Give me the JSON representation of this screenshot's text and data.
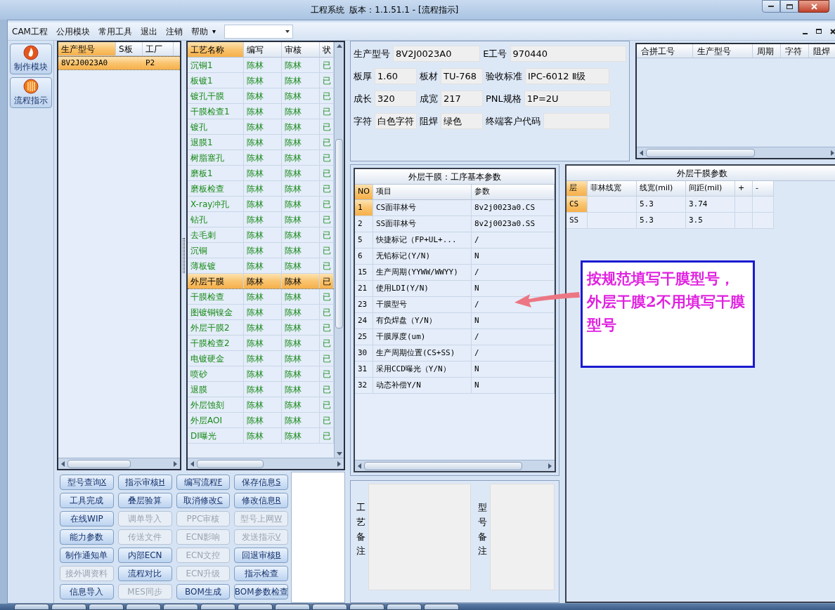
{
  "window": {
    "title": "工程系统  版本：1.1.51.1 - [流程指示]"
  },
  "menu": {
    "items": [
      "CAM工程",
      "公用模块",
      "常用工具",
      "退出",
      "注销",
      "帮助"
    ],
    "caret": "▾"
  },
  "nav": {
    "buttons": [
      {
        "label": "制作模块",
        "kind": "flame"
      },
      {
        "label": "流程指示",
        "kind": "bars"
      }
    ]
  },
  "product_table": {
    "columns": [
      "生产型号",
      "S板",
      "工厂"
    ],
    "rows": [
      {
        "cells": [
          "8V2J0023A0",
          "",
          "P2"
        ],
        "selected": true
      }
    ]
  },
  "process_table": {
    "columns": [
      "工艺名称",
      "编写",
      "审核",
      "状"
    ],
    "rows": [
      {
        "cells": [
          "沉铜1",
          "陈林",
          "陈林",
          "已"
        ],
        "selected": false
      },
      {
        "cells": [
          "板镀1",
          "陈林",
          "陈林",
          "已"
        ],
        "selected": false
      },
      {
        "cells": [
          "镀孔干膜",
          "陈林",
          "陈林",
          "已"
        ],
        "selected": false
      },
      {
        "cells": [
          "干膜检查1",
          "陈林",
          "陈林",
          "已"
        ],
        "selected": false
      },
      {
        "cells": [
          "镀孔",
          "陈林",
          "陈林",
          "已"
        ],
        "selected": false
      },
      {
        "cells": [
          "退膜1",
          "陈林",
          "陈林",
          "已"
        ],
        "selected": false
      },
      {
        "cells": [
          "树脂塞孔",
          "陈林",
          "陈林",
          "已"
        ],
        "selected": false
      },
      {
        "cells": [
          "磨板1",
          "陈林",
          "陈林",
          "已"
        ],
        "selected": false
      },
      {
        "cells": [
          "磨板检查",
          "陈林",
          "陈林",
          "已"
        ],
        "selected": false
      },
      {
        "cells": [
          "X-ray冲孔",
          "陈林",
          "陈林",
          "已"
        ],
        "selected": false
      },
      {
        "cells": [
          "钻孔",
          "陈林",
          "陈林",
          "已"
        ],
        "selected": false
      },
      {
        "cells": [
          "去毛刺",
          "陈林",
          "陈林",
          "已"
        ],
        "selected": false
      },
      {
        "cells": [
          "沉铜",
          "陈林",
          "陈林",
          "已"
        ],
        "selected": false
      },
      {
        "cells": [
          "薄板镀",
          "陈林",
          "陈林",
          "已"
        ],
        "selected": false
      },
      {
        "cells": [
          "外层干膜",
          "陈林",
          "陈林",
          "已"
        ],
        "selected": true
      },
      {
        "cells": [
          "干膜检查",
          "陈林",
          "陈林",
          "已"
        ],
        "selected": false
      },
      {
        "cells": [
          "图镀铜镍金",
          "陈林",
          "陈林",
          "已"
        ],
        "selected": false
      },
      {
        "cells": [
          "外层干膜2",
          "陈林",
          "陈林",
          "已"
        ],
        "selected": false
      },
      {
        "cells": [
          "干膜检查2",
          "陈林",
          "陈林",
          "已"
        ],
        "selected": false
      },
      {
        "cells": [
          "电镀硬金",
          "陈林",
          "陈林",
          "已"
        ],
        "selected": false
      },
      {
        "cells": [
          "喷砂",
          "陈林",
          "陈林",
          "已"
        ],
        "selected": false
      },
      {
        "cells": [
          "退膜",
          "陈林",
          "陈林",
          "已"
        ],
        "selected": false
      },
      {
        "cells": [
          "外层蚀刻",
          "陈林",
          "陈林",
          "已"
        ],
        "selected": false
      },
      {
        "cells": [
          "外层AOI",
          "陈林",
          "陈林",
          "已"
        ],
        "selected": false
      },
      {
        "cells": [
          "DI曝光",
          "陈林",
          "陈林",
          "已"
        ],
        "selected": false
      }
    ]
  },
  "buttons": [
    {
      "label": "型号查询",
      "key": "X",
      "disabled": false
    },
    {
      "label": "指示审核",
      "key": "H",
      "disabled": false
    },
    {
      "label": "编写流程",
      "key": "F",
      "disabled": false
    },
    {
      "label": "保存信息",
      "key": "S",
      "disabled": false
    },
    {
      "label": "工具完成",
      "disabled": false
    },
    {
      "label": "叠层验算",
      "disabled": false
    },
    {
      "label": "取消修改",
      "key": "C",
      "disabled": false
    },
    {
      "label": "修改信息",
      "key": "R",
      "disabled": false
    },
    {
      "label": "在线WIP",
      "disabled": false
    },
    {
      "label": "调单导入",
      "disabled": true
    },
    {
      "label": "PPC审核",
      "disabled": true
    },
    {
      "label": "型号上网",
      "key": "W",
      "disabled": true
    },
    {
      "label": "能力参数",
      "disabled": false
    },
    {
      "label": "传送文件",
      "disabled": true
    },
    {
      "label": "ECN影响",
      "disabled": true
    },
    {
      "label": "发送指示",
      "key": "V",
      "disabled": true
    },
    {
      "label": "制作通知单",
      "disabled": false
    },
    {
      "label": "内部ECN",
      "disabled": false
    },
    {
      "label": "ECN文控",
      "disabled": true
    },
    {
      "label": "回退审核",
      "key": "B",
      "disabled": false
    },
    {
      "label": "接外调资料",
      "disabled": true
    },
    {
      "label": "流程对比",
      "disabled": false
    },
    {
      "label": "ECN升级",
      "disabled": true
    },
    {
      "label": "指示检查",
      "disabled": false
    },
    {
      "label": "信息导入",
      "disabled": false
    },
    {
      "label": "MES同步",
      "disabled": true
    },
    {
      "label": "BOM生成",
      "disabled": false
    },
    {
      "label": "BOM参数检查",
      "disabled": false
    }
  ],
  "info": {
    "fields": [
      {
        "label": "生产型号",
        "value": "8V2J0023A0"
      },
      {
        "label": "E工号",
        "value": "970440"
      },
      {
        "label": "板厚",
        "value": "1.60"
      },
      {
        "label": "板材",
        "value": "TU-768"
      },
      {
        "label": "验收标准",
        "value": "IPC-6012 Ⅱ级"
      },
      {
        "label": "成长",
        "value": "320"
      },
      {
        "label": "成宽",
        "value": "217"
      },
      {
        "label": "PNL规格",
        "value": "1P=2U"
      },
      {
        "label": "字符",
        "value": "白色字符"
      },
      {
        "label": "阻焊",
        "value": "绿色"
      },
      {
        "label": "终端客户代码"
      }
    ]
  },
  "merge_table": {
    "columns": [
      "合拼工号",
      "生产型号",
      "周期",
      "字符",
      "阻焊"
    ]
  },
  "params": {
    "title": "外层干膜：工序基本参数",
    "columns": [
      "NO",
      "项目",
      "参数"
    ],
    "rows": [
      {
        "cells": [
          "1",
          "CS面菲林号",
          "8v2j0023a0.CS"
        ],
        "selected": true
      },
      {
        "cells": [
          "2",
          "SS面菲林号",
          "8v2j0023a0.SS"
        ],
        "selected": false
      },
      {
        "cells": [
          "5",
          "快捷标记（FP+UL+...",
          "/"
        ],
        "selected": false
      },
      {
        "cells": [
          "6",
          "无铅标记(Y/N)",
          "N"
        ],
        "selected": false
      },
      {
        "cells": [
          "15",
          "生产周期(YYWW/WWYY)",
          "/"
        ],
        "selected": false
      },
      {
        "cells": [
          "21",
          "使用LDI(Y/N)",
          "N"
        ],
        "selected": false
      },
      {
        "cells": [
          "23",
          "干膜型号",
          "/"
        ],
        "selected": false
      },
      {
        "cells": [
          "24",
          "有负焊盘（Y/N）",
          "N"
        ],
        "selected": false
      },
      {
        "cells": [
          "25",
          "干膜厚度(um)",
          "/"
        ],
        "selected": false
      },
      {
        "cells": [
          "30",
          "生产周期位置(CS+SS)",
          "/"
        ],
        "selected": false
      },
      {
        "cells": [
          "31",
          "采用CCD曝光（Y/N）",
          "N"
        ],
        "selected": false
      },
      {
        "cells": [
          "32",
          "动态补偿Y/N",
          "N"
        ],
        "selected": false
      }
    ]
  },
  "film": {
    "title": "外层干膜参数",
    "columns": [
      "层",
      "菲林线宽",
      "线宽(mil)",
      "间距(mil)",
      "+",
      "-"
    ],
    "rows": [
      {
        "cells": [
          "CS",
          "",
          "5.3",
          "3.74",
          "",
          ""
        ],
        "selected": true
      },
      {
        "cells": [
          "SS",
          "",
          "5.3",
          "3.5",
          "",
          ""
        ],
        "selected": false
      }
    ]
  },
  "notes": {
    "labels": [
      "工艺备注",
      "型号备注"
    ]
  },
  "annotation": {
    "text": "按规范填写干膜型号，外层干膜2不用填写干膜型号"
  }
}
